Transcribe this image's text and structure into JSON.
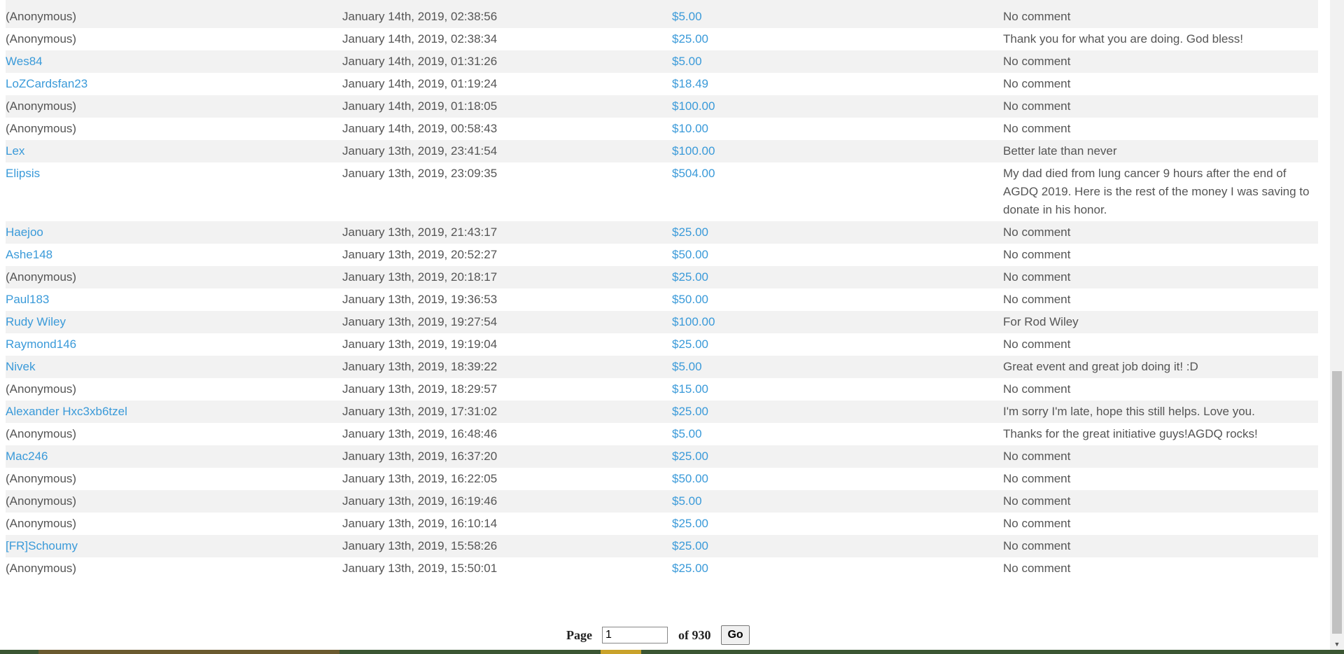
{
  "donations": [
    {
      "name": "(Anonymous)",
      "time": "January 14th, 2019, 02:38:56",
      "amount": "$5.00",
      "comment": "No comment"
    },
    {
      "name": "(Anonymous)",
      "time": "January 14th, 2019, 02:38:34",
      "amount": "$25.00",
      "comment": "Thank you for what you are doing. God bless!"
    },
    {
      "name": "Wes84",
      "time": "January 14th, 2019, 01:31:26",
      "amount": "$5.00",
      "comment": "No comment"
    },
    {
      "name": "LoZCardsfan23",
      "time": "January 14th, 2019, 01:19:24",
      "amount": "$18.49",
      "comment": "No comment"
    },
    {
      "name": "(Anonymous)",
      "time": "January 14th, 2019, 01:18:05",
      "amount": "$100.00",
      "comment": "No comment"
    },
    {
      "name": "(Anonymous)",
      "time": "January 14th, 2019, 00:58:43",
      "amount": "$10.00",
      "comment": "No comment"
    },
    {
      "name": "Lex",
      "time": "January 13th, 2019, 23:41:54",
      "amount": "$100.00",
      "comment": "Better late than never"
    },
    {
      "name": "Elipsis",
      "time": "January 13th, 2019, 23:09:35",
      "amount": "$504.00",
      "comment": "My dad died from lung cancer 9 hours after the end of AGDQ 2019. Here is the rest of the money I was saving to donate in his honor."
    },
    {
      "name": "Haejoo",
      "time": "January 13th, 2019, 21:43:17",
      "amount": "$25.00",
      "comment": "No comment"
    },
    {
      "name": "Ashe148",
      "time": "January 13th, 2019, 20:52:27",
      "amount": "$50.00",
      "comment": "No comment"
    },
    {
      "name": "(Anonymous)",
      "time": "January 13th, 2019, 20:18:17",
      "amount": "$25.00",
      "comment": "No comment"
    },
    {
      "name": "Paul183",
      "time": "January 13th, 2019, 19:36:53",
      "amount": "$50.00",
      "comment": "No comment"
    },
    {
      "name": "Rudy Wiley",
      "time": "January 13th, 2019, 19:27:54",
      "amount": "$100.00",
      "comment": "For Rod Wiley"
    },
    {
      "name": "Raymond146",
      "time": "January 13th, 2019, 19:19:04",
      "amount": "$25.00",
      "comment": "No comment"
    },
    {
      "name": "Nivek",
      "time": "January 13th, 2019, 18:39:22",
      "amount": "$5.00",
      "comment": "Great event and great job doing it! :D"
    },
    {
      "name": "(Anonymous)",
      "time": "January 13th, 2019, 18:29:57",
      "amount": "$15.00",
      "comment": "No comment"
    },
    {
      "name": "Alexander Hxc3xb6tzel",
      "time": "January 13th, 2019, 17:31:02",
      "amount": "$25.00",
      "comment": "I'm sorry I'm late, hope this still helps. Love you."
    },
    {
      "name": "(Anonymous)",
      "time": "January 13th, 2019, 16:48:46",
      "amount": "$5.00",
      "comment": "Thanks for the great initiative guys!AGDQ rocks!"
    },
    {
      "name": "Mac246",
      "time": "January 13th, 2019, 16:37:20",
      "amount": "$25.00",
      "comment": "No comment"
    },
    {
      "name": "(Anonymous)",
      "time": "January 13th, 2019, 16:22:05",
      "amount": "$50.00",
      "comment": "No comment"
    },
    {
      "name": "(Anonymous)",
      "time": "January 13th, 2019, 16:19:46",
      "amount": "$5.00",
      "comment": "No comment"
    },
    {
      "name": "(Anonymous)",
      "time": "January 13th, 2019, 16:10:14",
      "amount": "$25.00",
      "comment": "No comment"
    },
    {
      "name": "[FR]Schoumy",
      "time": "January 13th, 2019, 15:58:26",
      "amount": "$25.00",
      "comment": "No comment"
    },
    {
      "name": "(Anonymous)",
      "time": "January 13th, 2019, 15:50:01",
      "amount": "$25.00",
      "comment": "No comment"
    }
  ],
  "pagination": {
    "page_label": "Page",
    "current_page": "1",
    "of_label": "of 930",
    "go_label": "Go"
  },
  "colors": {
    "link": "#3a9ad9",
    "text": "#555555",
    "row_alt": "#f2f2f2"
  },
  "icons": {
    "scroll_down": "▼"
  }
}
